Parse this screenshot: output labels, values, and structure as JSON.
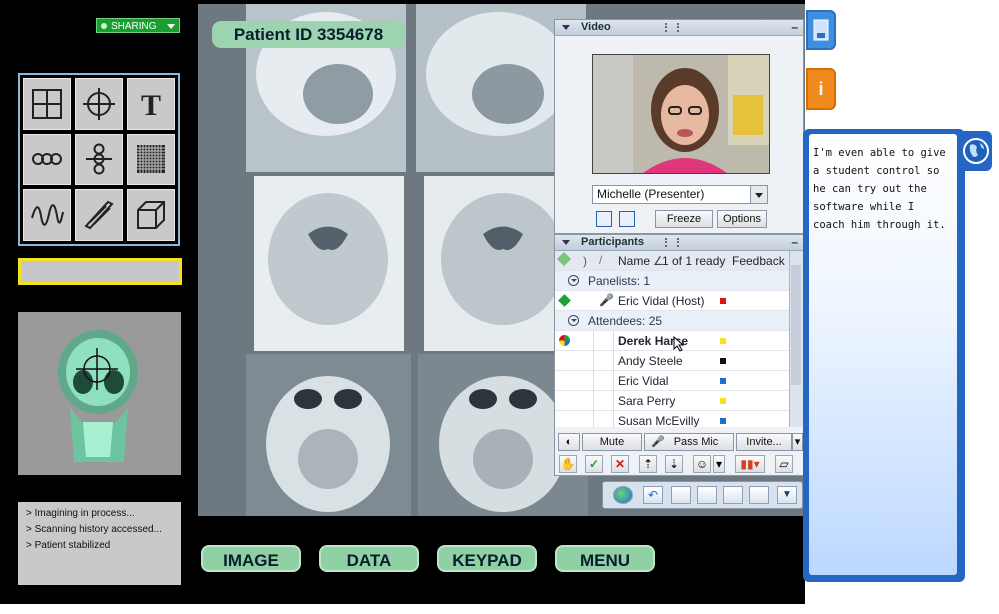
{
  "header": {
    "sharing_label": "SHARING"
  },
  "patient": {
    "id_label": "Patient ID  3354678"
  },
  "log": {
    "lines": [
      "> Imagining in process...",
      "> Scanning history accessed...",
      "> Patient stabilized"
    ]
  },
  "nav_buttons": {
    "image": "IMAGE",
    "data": "DATA",
    "keypad": "KEYPAD",
    "menu": "MENU"
  },
  "video_panel": {
    "title": "Video",
    "presenter": "Michelle (Presenter)",
    "freeze": "Freeze",
    "options": "Options"
  },
  "participants_panel": {
    "title": "Participants",
    "col_name": "Name",
    "ready_status": "1 of 1 ready",
    "col_feedback": "Feedback",
    "panelists_group": "Panelists: 1",
    "attendees_group": "Attendees: 25",
    "panelists": [
      {
        "name": "Eric Vidal (Host)",
        "color": "#e01010"
      }
    ],
    "attendees": [
      {
        "name": "Derek Harse",
        "color": "#f5e21a"
      },
      {
        "name": "Andy Steele",
        "color": "#111111"
      },
      {
        "name": "Eric Vidal",
        "color": "#1e6fd0"
      },
      {
        "name": "Sara Perry",
        "color": "#f5e21a"
      },
      {
        "name": "Susan McEvilly",
        "color": "#1e6fd0"
      }
    ],
    "mute": "Mute",
    "pass_mic": "Pass Mic",
    "invite": "Invite..."
  },
  "notes": {
    "text": "I'm even able to give a student control so he can  try out the software while I coach him through it."
  },
  "side_tabs": {
    "info": "i"
  },
  "colors": {
    "accent_green": "#8fd0a5",
    "notes_blue": "#2566c5",
    "sharing_green": "#1c9d32"
  }
}
